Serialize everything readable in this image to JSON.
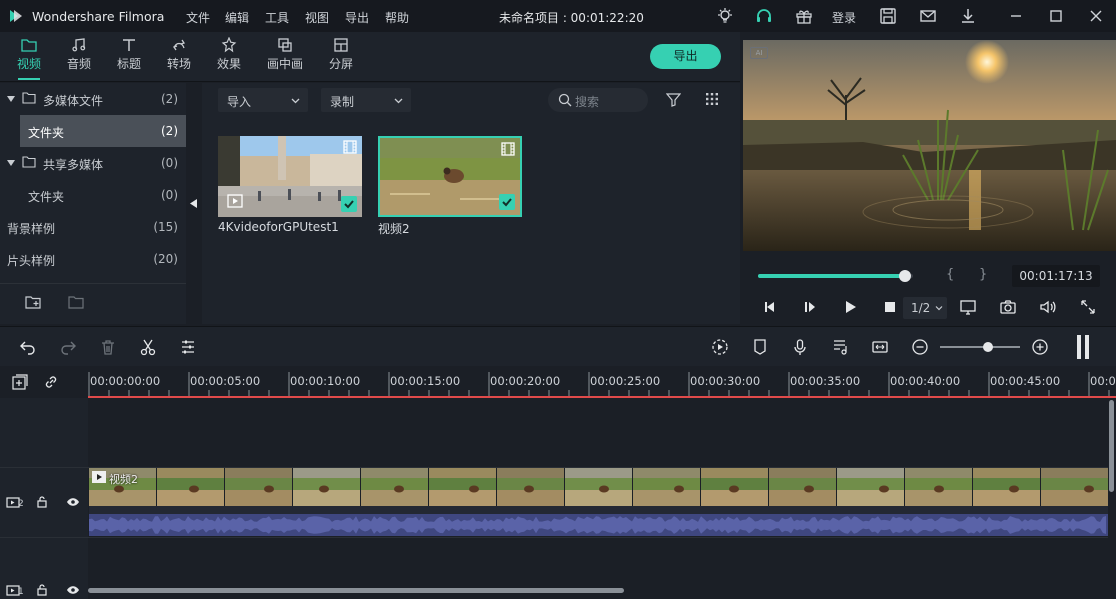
{
  "app": {
    "name": "Wondershare Filmora",
    "menu": [
      "文件",
      "编辑",
      "工具",
      "视图",
      "导出",
      "帮助"
    ],
    "project_title": "未命名项目 : 00:01:22:20",
    "login_label": "登录"
  },
  "tabs": [
    {
      "label": "视频",
      "icon": "folder-icon",
      "active": true
    },
    {
      "label": "音频",
      "icon": "music-note-icon",
      "active": false
    },
    {
      "label": "标题",
      "icon": "text-icon",
      "active": false
    },
    {
      "label": "转场",
      "icon": "transition-icon",
      "active": false
    },
    {
      "label": "效果",
      "icon": "effects-icon",
      "active": false
    },
    {
      "label": "画中画",
      "icon": "pip-icon",
      "active": false
    },
    {
      "label": "分屏",
      "icon": "split-screen-icon",
      "active": false
    }
  ],
  "export_label": "导出",
  "library": {
    "items": [
      {
        "label": "多媒体文件",
        "count": "(2)"
      },
      {
        "label": "文件夹",
        "count": "(2)"
      },
      {
        "label": "共享多媒体",
        "count": "(0)"
      },
      {
        "label": "文件夹",
        "count": "(0)"
      },
      {
        "label": "背景样例",
        "count": "(15)"
      },
      {
        "label": "片头样例",
        "count": "(20)"
      }
    ]
  },
  "media": {
    "import_label": "导入",
    "record_label": "录制",
    "search_placeholder": "搜索",
    "clips": [
      {
        "name": "4KvideoforGPUtest1"
      },
      {
        "name": "视频2"
      }
    ]
  },
  "preview": {
    "ai_badge": "AI",
    "timecode": "00:01:17:13",
    "progress": 0.95,
    "speed": "1/2",
    "mark_in": "{",
    "mark_out": "}"
  },
  "timeline": {
    "ruler": [
      "00:00:00:00",
      "00:00:05:00",
      "00:00:10:00",
      "00:00:15:00",
      "00:00:20:00",
      "00:00:25:00",
      "00:00:30:00",
      "00:00:35:00",
      "00:00:40:00",
      "00:00:45:00",
      "00:0"
    ],
    "clip_label": "视频2",
    "zoom_level": 0.6,
    "tracks": [
      {
        "number": "2"
      },
      {
        "number": "1"
      }
    ]
  },
  "colors": {
    "accent": "#36d0b2",
    "playhead": "#e04a4a",
    "waveform": "#5a63a8"
  }
}
